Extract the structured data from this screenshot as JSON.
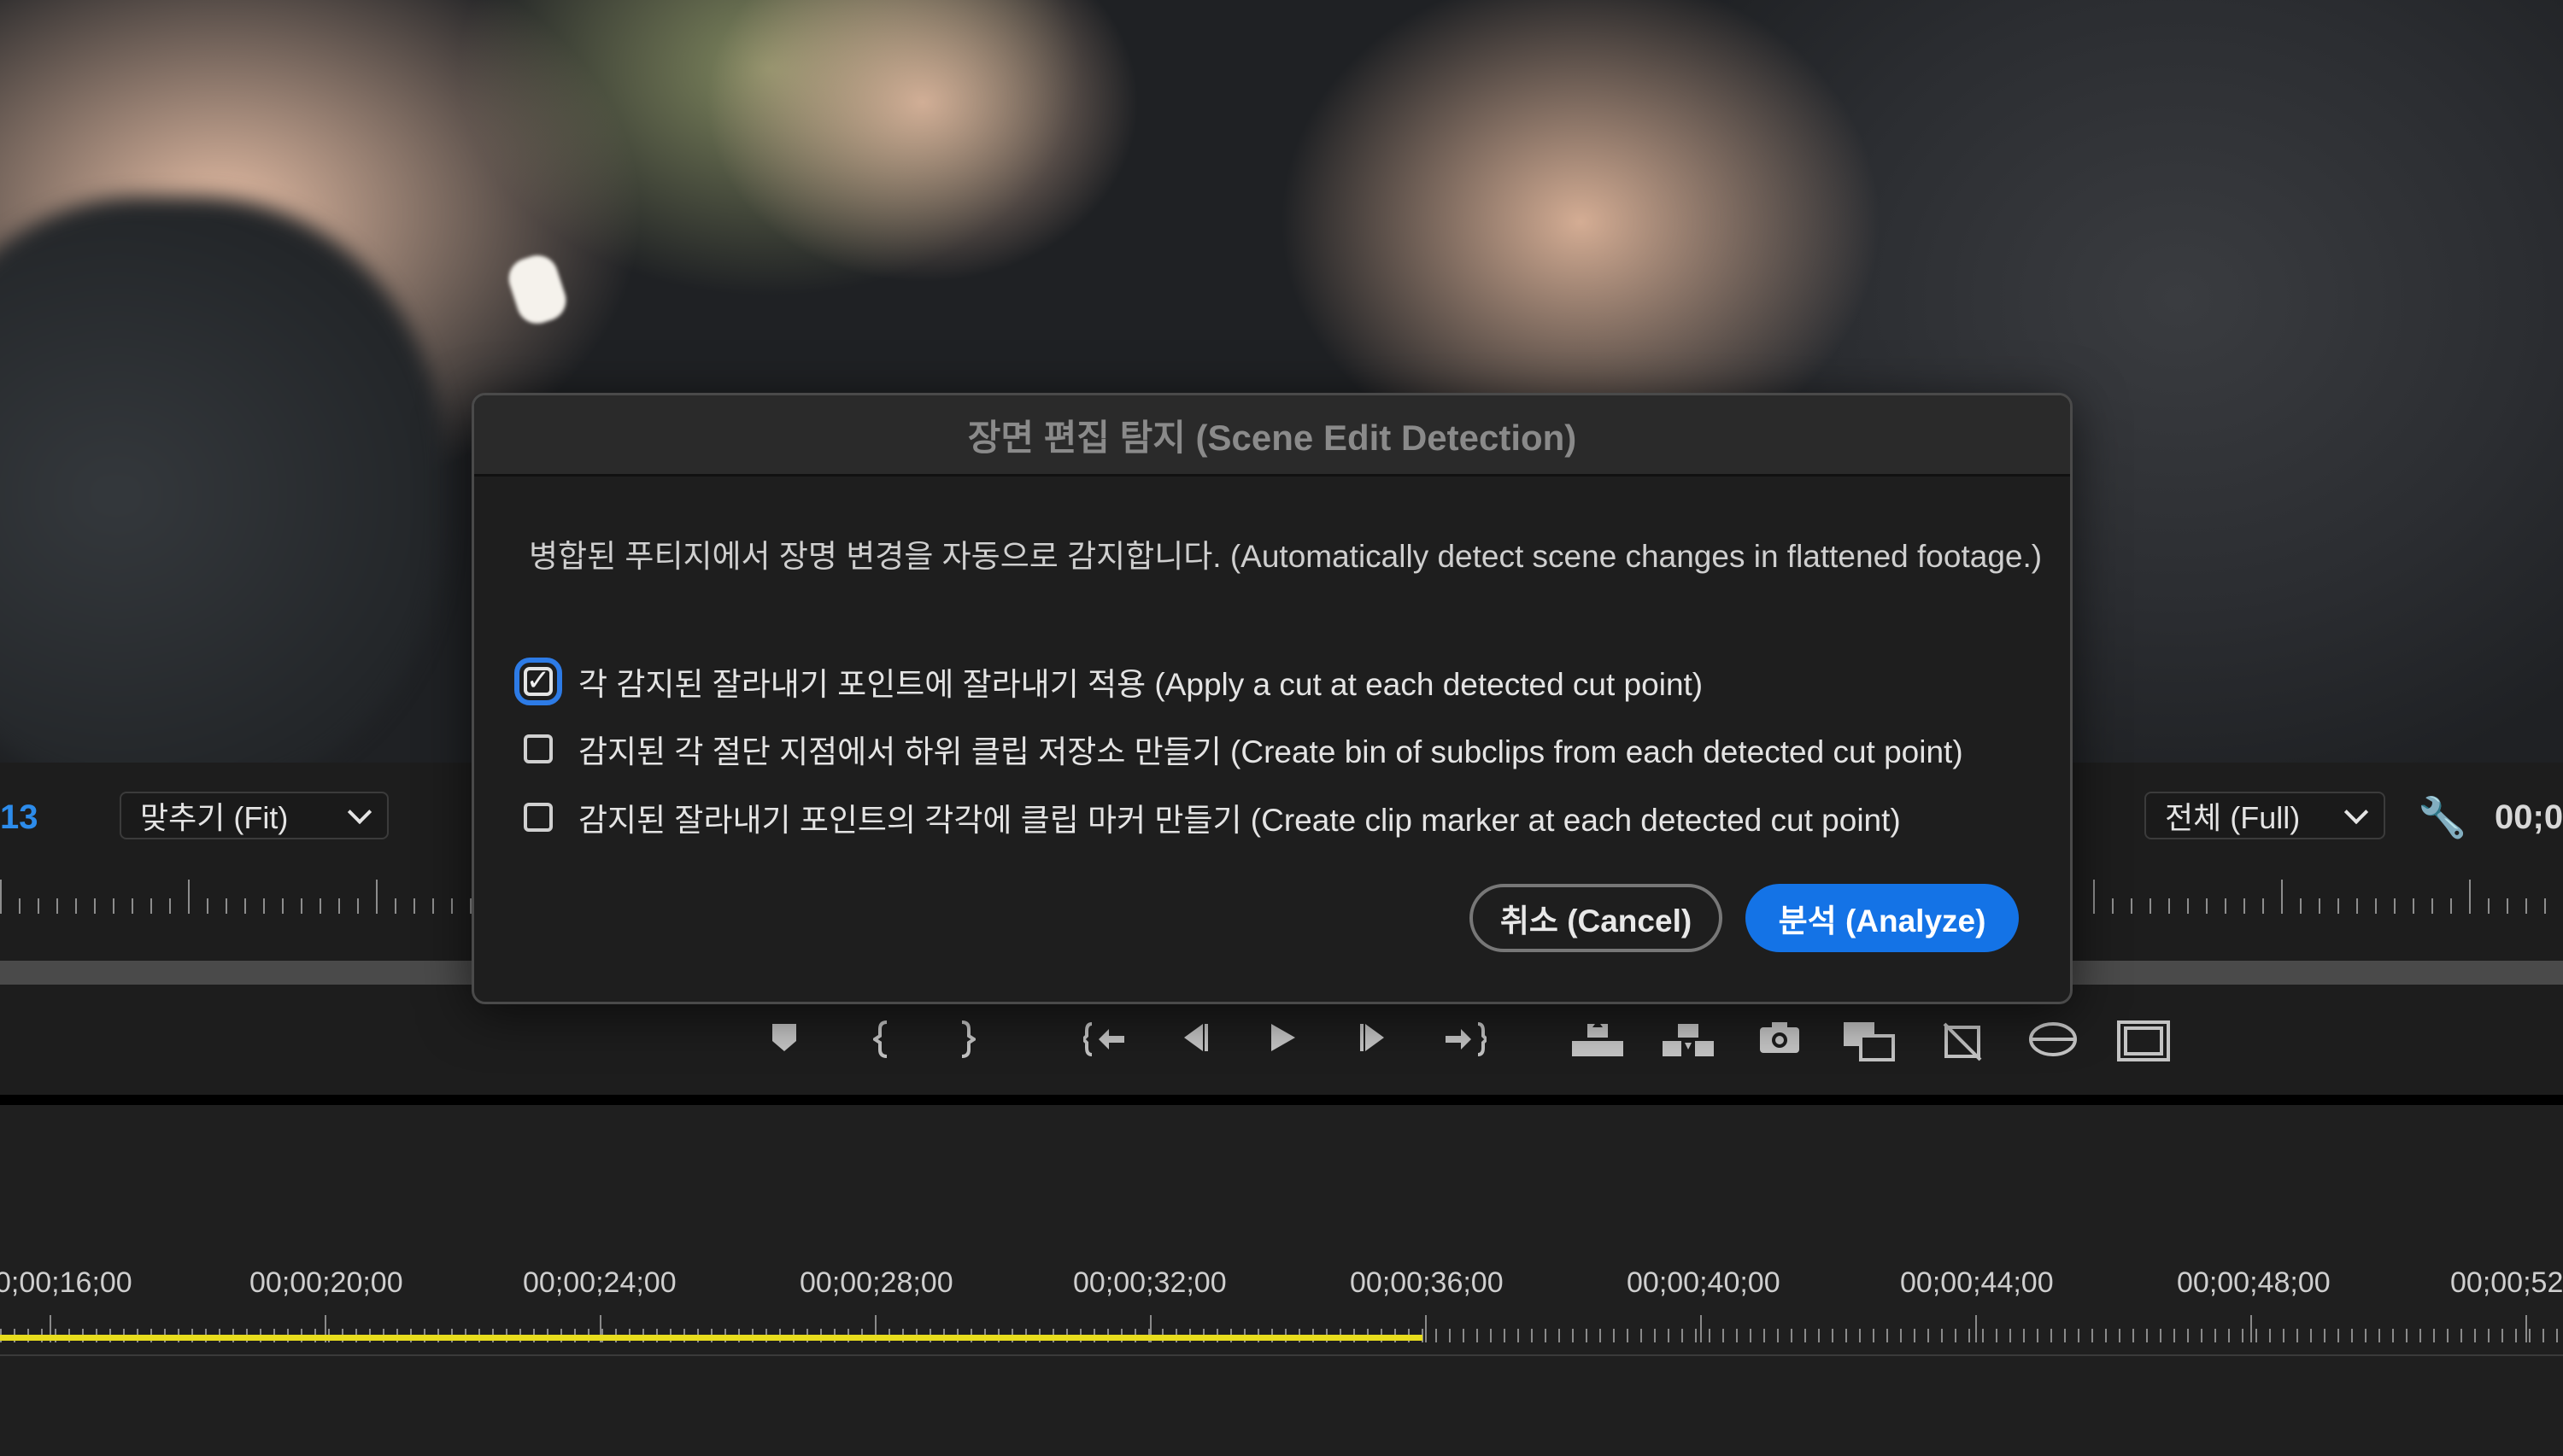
{
  "monitor": {
    "timecode_left": "13",
    "zoom_dropdown": "맞추기 (Fit)",
    "resolution_dropdown": "전체 (Full)",
    "timecode_right": "00;0"
  },
  "transport_icons": [
    "add-marker-icon",
    "mark-in-icon",
    "mark-out-icon",
    "go-to-in-icon",
    "step-back-icon",
    "play-icon",
    "step-forward-icon",
    "go-to-out-icon",
    "lift-icon",
    "extract-icon",
    "export-frame-icon",
    "comparison-view-icon",
    "toggle-proxies-icon",
    "vr-video-icon",
    "safe-margins-icon"
  ],
  "timeline": {
    "labels": [
      "0;00;16;00",
      "00;00;20;00",
      "00;00;24;00",
      "00;00;28;00",
      "00;00;32;00",
      "00;00;36;00",
      "00;00;40;00",
      "00;00;44;00",
      "00;00;48;00",
      "00;00;52"
    ],
    "playhead_fraction": 0.555
  },
  "dialog": {
    "title": "장면 편집 탐지 (Scene Edit Detection)",
    "description": "병합된 푸티지에서 장명 변경을 자동으로 감지합니다. (Automatically detect scene changes in flattened footage.)",
    "options": [
      {
        "label": "각 감지된 잘라내기 포인트에 잘라내기 적용 (Apply a cut at each detected cut point)",
        "checked": true
      },
      {
        "label": "감지된 각 절단 지점에서 하위 클립 저장소 만들기 (Create bin of subclips from each detected cut point)",
        "checked": false
      },
      {
        "label": "감지된 잘라내기 포인트의 각각에 클립 마커 만들기 (Create clip marker at each detected cut point)",
        "checked": false
      }
    ],
    "cancel_label": "취소 (Cancel)",
    "analyze_label": "분석 (Analyze)",
    "accent_color": "#1473e6"
  }
}
